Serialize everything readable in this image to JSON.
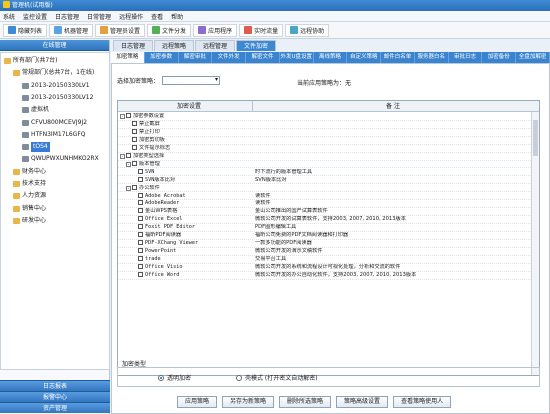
{
  "window": {
    "title": "管理机(试用版)"
  },
  "menu": [
    "系统",
    "监控设置",
    "日志管理",
    "日常管理",
    "远程操作",
    "查看",
    "帮助"
  ],
  "toolbar": [
    {
      "label": "隐藏列表",
      "color": "#3b8bd8"
    },
    {
      "label": "机器管理",
      "color": "#5aa3e6"
    },
    {
      "label": "管理员设置",
      "color": "#e2a03f"
    },
    {
      "label": "文件分发",
      "color": "#54b056"
    },
    {
      "label": "应用程序",
      "color": "#8f6bd1"
    },
    {
      "label": "实时流量",
      "color": "#e05a4f"
    },
    {
      "label": "远程协助",
      "color": "#4aa6c9"
    }
  ],
  "left": {
    "header": "在线管理",
    "tree": [
      {
        "label": "所有部门(共7台)",
        "kind": "fold",
        "level": 0
      },
      {
        "label": "常规部门(总共7台，1在线)",
        "kind": "fold",
        "level": 1
      },
      {
        "label": "2013-20150330LV1",
        "kind": "pc",
        "level": 2
      },
      {
        "label": "2013-20150330LV12",
        "kind": "pc",
        "level": 2
      },
      {
        "label": "虚拟机",
        "kind": "pc",
        "level": 2
      },
      {
        "label": "CFVU800MCEVJ9J2",
        "kind": "pc",
        "level": 2
      },
      {
        "label": "HTFN3IM17L6GFQ",
        "kind": "pc",
        "level": 2
      },
      {
        "label": "tOS4",
        "kind": "pc",
        "level": 2,
        "selected": true
      },
      {
        "label": "QWUPWXUNHMKO2RX",
        "kind": "pc",
        "level": 2
      },
      {
        "label": "财务中心",
        "kind": "fold",
        "level": 1
      },
      {
        "label": "技术支持",
        "kind": "fold",
        "level": 1
      },
      {
        "label": "人力资源",
        "kind": "fold",
        "level": 1
      },
      {
        "label": "销售中心",
        "kind": "fold",
        "level": 1
      },
      {
        "label": "研发中心",
        "kind": "fold",
        "level": 1
      }
    ],
    "footers": [
      "日志报表",
      "报警中心",
      "资产管理"
    ]
  },
  "tabs_main": [
    {
      "label": "日志管理",
      "active": false
    },
    {
      "label": "远程策略",
      "active": false
    },
    {
      "label": "远程管理",
      "active": false
    },
    {
      "label": "文件加密",
      "active": true
    }
  ],
  "tabs_sub": [
    {
      "label": "加密策略",
      "active": true
    },
    {
      "label": "加密参数",
      "active": false
    },
    {
      "label": "解密审批",
      "active": false
    },
    {
      "label": "文件外发",
      "active": false
    },
    {
      "label": "解密文件",
      "active": false
    },
    {
      "label": "外发U盘设置",
      "active": false
    },
    {
      "label": "离线策略",
      "active": false
    },
    {
      "label": "自定义策略",
      "active": false
    },
    {
      "label": "邮件白名单",
      "active": false
    },
    {
      "label": "服务器白名单",
      "active": false
    },
    {
      "label": "审批日志",
      "active": false
    },
    {
      "label": "加密备份",
      "active": false
    },
    {
      "label": "全盘加解密",
      "active": false
    }
  ],
  "strategy": {
    "select_label": "选择加密策略：",
    "selected": "",
    "current_label": "当前应用策略为：",
    "current_value": "无"
  },
  "grid": {
    "headers": [
      "加密设置",
      "备 注"
    ],
    "rows": [
      {
        "indent": 0,
        "expander": "-",
        "checkbox": true,
        "label": "加密参数设置",
        "note": "",
        "mono": false
      },
      {
        "indent": 2,
        "expander": "",
        "checkbox": true,
        "label": "禁止截屏",
        "note": "",
        "mono": false
      },
      {
        "indent": 2,
        "expander": "",
        "checkbox": true,
        "label": "禁止打印",
        "note": "",
        "mono": false
      },
      {
        "indent": 2,
        "expander": "",
        "checkbox": true,
        "label": "加密剪切板",
        "note": "",
        "mono": false
      },
      {
        "indent": 2,
        "expander": "",
        "checkbox": true,
        "label": "文件提示标志",
        "note": "",
        "mono": false
      },
      {
        "indent": 0,
        "expander": "-",
        "checkbox": true,
        "label": "加密类型选择",
        "note": "",
        "mono": false
      },
      {
        "indent": 1,
        "expander": "-",
        "checkbox": true,
        "label": "版本管理",
        "note": "",
        "mono": false
      },
      {
        "indent": 3,
        "expander": "",
        "checkbox": true,
        "label": "SVN",
        "note": "时下流行的版本管理工具",
        "mono": true
      },
      {
        "indent": 3,
        "expander": "",
        "checkbox": true,
        "label": "SVN版本比对",
        "note": "SVN版本比对",
        "mono": true
      },
      {
        "indent": 1,
        "expander": "-",
        "checkbox": true,
        "label": "办公软件",
        "note": "",
        "mono": false
      },
      {
        "indent": 3,
        "expander": "",
        "checkbox": true,
        "label": "Adobe Acrobat",
        "note": "读软件",
        "mono": true
      },
      {
        "indent": 3,
        "expander": "",
        "checkbox": true,
        "label": "AdobeReader",
        "note": "读软件",
        "mono": true
      },
      {
        "indent": 3,
        "expander": "",
        "checkbox": true,
        "label": "金山WPS表格",
        "note": "金山公司推出的国产试算表软件",
        "mono": false
      },
      {
        "indent": 3,
        "expander": "",
        "checkbox": true,
        "label": "Office Excel",
        "note": "微软公司开发的试算表软件，支持2003, 2007, 2010, 2013版本",
        "mono": true
      },
      {
        "indent": 3,
        "expander": "",
        "checkbox": true,
        "label": "Foxit PDF Editor",
        "note": "PDF图形编辑工具",
        "mono": true
      },
      {
        "indent": 3,
        "expander": "",
        "checkbox": true,
        "label": "福昕PDF阅读器",
        "note": "福昕公司免费的PDF文档阅读器和打印器",
        "mono": false
      },
      {
        "indent": 3,
        "expander": "",
        "checkbox": true,
        "label": "PDF-XChang Viewer",
        "note": "一款多功能的PDF阅读器",
        "mono": true
      },
      {
        "indent": 3,
        "expander": "",
        "checkbox": true,
        "label": "PowerPoint",
        "note": "微软公司开发的演示文稿软件",
        "mono": true
      },
      {
        "indent": 3,
        "expander": "",
        "checkbox": true,
        "label": "trade",
        "note": "交易平台工具",
        "mono": true
      },
      {
        "indent": 3,
        "expander": "",
        "checkbox": true,
        "label": "Office Visio",
        "note": "微软公司开发的系统和流程设计可视化处理，分析和交流的软件",
        "mono": true
      },
      {
        "indent": 3,
        "expander": "",
        "checkbox": true,
        "label": "Office Word",
        "note": "微软公司开发的办公自动化软件，支持2003, 2007, 2010, 2013版本",
        "mono": true
      }
    ]
  },
  "encryption": {
    "label": "加密类型",
    "options": [
      {
        "label": "透明加密",
        "selected": true
      },
      {
        "label": "壳模式 (打开密文自动解密)",
        "selected": false
      }
    ]
  },
  "buttons": [
    "应用策略",
    "另存为新策略",
    "删除所选策略",
    "策略高级设置",
    "查看策略使用人"
  ]
}
